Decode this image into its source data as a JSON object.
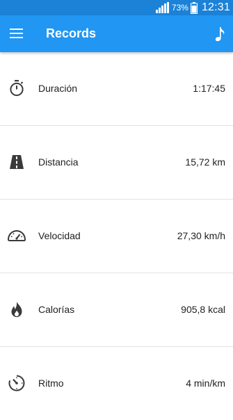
{
  "status_bar": {
    "battery_percent": "73%",
    "time": "12:31"
  },
  "app_bar": {
    "title": "Records",
    "menu_icon": "hamburger-menu-icon",
    "action_icon": "music-note-icon",
    "color": "#2196f3"
  },
  "records": [
    {
      "icon": "stopwatch-icon",
      "label": "Duración",
      "value": "1:17:45"
    },
    {
      "icon": "road-icon",
      "label": "Distancia",
      "value": "15,72 km"
    },
    {
      "icon": "speedometer-icon",
      "label": "Velocidad",
      "value": "27,30 km/h"
    },
    {
      "icon": "flame-icon",
      "label": "Calorías",
      "value": "905,8 kcal"
    },
    {
      "icon": "pace-gauge-icon",
      "label": "Ritmo",
      "value": "4 min/km"
    }
  ]
}
